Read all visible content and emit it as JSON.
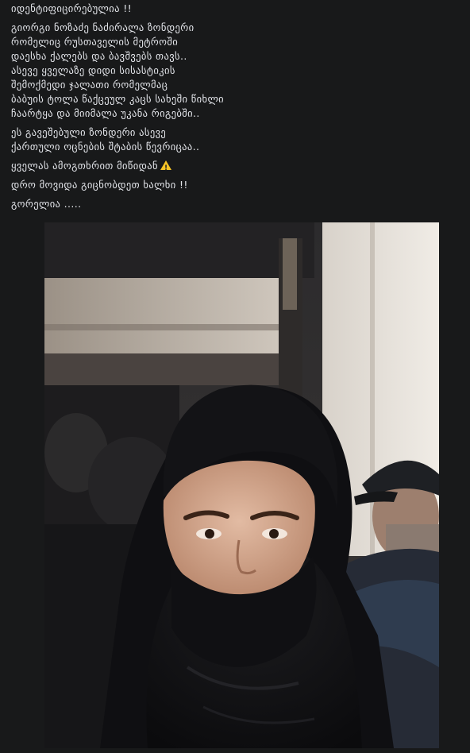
{
  "post": {
    "paragraphs": [
      [
        "იდენტიფიცირებულია !!"
      ],
      [
        "გიორგი ნოზაძე ნაძირალა ზონდერი",
        "რომელიც რუსთაველის მეტროში",
        "დაესხა ქალებს და ბავშვებს თავს..",
        "ასევე ყველაზე დიდი სისასტიკის",
        "შემოქმედი ჯალათი რომელმაც",
        "ბაბუის ტოლა წაქცეულ კაცს სახეში წიხლი",
        "ჩაარტყა და მიიმალა უკანა რიგებში.."
      ],
      [
        "ეს გავეშებული ზონდერი ასევე",
        "ქართული ოცნების შტაბის წევრიცაა.."
      ],
      [
        "ყველას ამოგთხრით მიწიდან"
      ],
      [
        "დრო მოვიდა გიცნობდეთ ხალხი !!"
      ],
      [
        "გორელია ....."
      ]
    ],
    "warning_icon": "warning-icon"
  },
  "photo": {
    "subject": "masked-person-photo"
  },
  "colors": {
    "background": "#18191a",
    "text": "#e4e6eb",
    "warning": "#f7c325"
  }
}
